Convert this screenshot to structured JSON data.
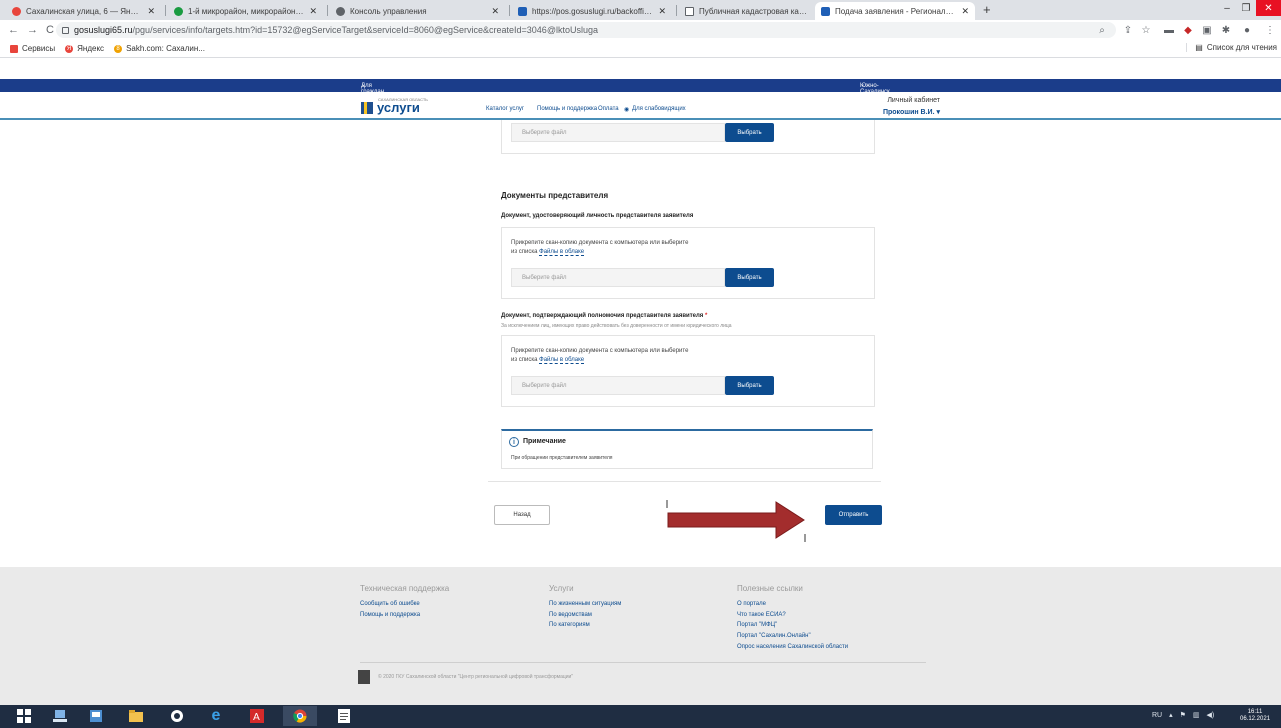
{
  "browser": {
    "tabs": [
      {
        "title": "Сахалинская улица, 6 — Яндекс",
        "icon": "map-pin-icon",
        "color": "#e8453c",
        "active": false
      },
      {
        "title": "1-й микрорайон, микрорайон…",
        "icon": "map-pin-icon",
        "color": "#1a9b41",
        "active": false
      },
      {
        "title": "Консоль управления",
        "icon": "globe-icon",
        "color": "#5f6368",
        "active": false
      },
      {
        "title": "https://pos.gosuslugi.ru/backoffi…",
        "icon": "gosuslugi-icon",
        "color": "#1f5fb6",
        "active": false
      },
      {
        "title": "Публичная кадастровая карта",
        "icon": "document-icon",
        "color": "#5f6368",
        "active": false
      },
      {
        "title": "Подача заявления - Региональн…",
        "icon": "gosuslugi-icon",
        "color": "#1f5fb6",
        "active": true
      }
    ],
    "new_tab": "+",
    "url_domain": "gosuslugi65.ru",
    "url_rest": "/pgu/services/info/targets.htm?id=15732@egServiceTarget&serviceId=8060@egService&createId=3046@lktoUsluga",
    "bookmarks": [
      {
        "label": "Сервисы",
        "color": "#e8453c"
      },
      {
        "label": "Яндекс",
        "color": "#e8453c"
      },
      {
        "label": "Sakh.com: Сахалин...",
        "color": "#f0a202"
      }
    ],
    "reading_list": "Список для чтения"
  },
  "site": {
    "top_left": "Для граждан",
    "top_right": "Южно-Сахалинск",
    "logo_word": "услуги",
    "logo_sup": "САХАЛИНСКАЯ ОБЛАСТЬ",
    "nav": [
      "Каталог услуг",
      "Помощь и поддержка",
      "Оплата",
      "Для слабовидящих"
    ],
    "cabinet": "Личный кабинет",
    "user": "Прокошин В.И."
  },
  "form": {
    "file_placeholder": "Выберите файл",
    "choose_label": "Выбрать",
    "section_title": "Документы представителя",
    "doc1_title": "Документ, удостоверяющий личность представителя заявителя",
    "doc2_title": "Документ, подтверждающий полномочия представителя заявителя",
    "required_mark": "*",
    "doc2_hint": "За исключением лиц, имеющих право действовать без доверенности от имени юридического лица",
    "attach_line1": "Прикрепите скан-копию документа с компьютера или выберите",
    "attach_line2_prefix": "из списка",
    "cloud_link": "Файлы в облаке",
    "note_title": "Примечание",
    "note_text": "При обращении представителем заявителя",
    "back_label": "Назад",
    "send_label": "Отправить"
  },
  "footer": {
    "col1_title": "Техническая поддержка",
    "col1_links": [
      "Сообщить об ошибке",
      "Помощь и поддержка"
    ],
    "col2_title": "Услуги",
    "col2_links": [
      "По жизненным ситуациям",
      "По ведомствам",
      "По категориям"
    ],
    "col3_title": "Полезные ссылки",
    "col3_links": [
      "О портале",
      "Что такое ЕСИА?",
      "Портал \"МФЦ\"",
      "Портал \"Сахалин.Онлайн\"",
      "Опрос населения Сахалинской области"
    ],
    "copyright": "© 2020 ГКУ Сахалинской области \"Центр региональной цифровой трансформации\""
  },
  "taskbar": {
    "lang": "RU",
    "time": "16:11",
    "date": "06.12.2021"
  }
}
